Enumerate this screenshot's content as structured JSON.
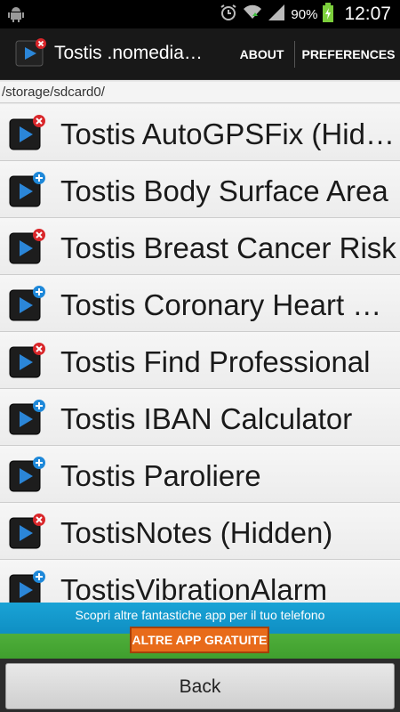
{
  "status_bar": {
    "battery_percent": "90%",
    "time": "12:07",
    "icons": [
      "android-icon",
      "alarm-icon",
      "wifi-icon",
      "signal-icon",
      "battery-charging-icon"
    ]
  },
  "action_bar": {
    "title": "Tostis .nomedia…",
    "about_label": "ABOUT",
    "preferences_label": "PREFERENCES"
  },
  "path": "/storage/sdcard0/",
  "list": {
    "items": [
      {
        "label": "Tostis AutoGPSFix (Hidden)",
        "state": "hidden"
      },
      {
        "label": "Tostis Body Surface Area",
        "state": "visible"
      },
      {
        "label": "Tostis Breast Cancer Risk",
        "state": "hidden"
      },
      {
        "label": "Tostis Coronary Heart Disease",
        "state": "visible"
      },
      {
        "label": "Tostis Find Professional",
        "state": "hidden"
      },
      {
        "label": "Tostis IBAN Calculator",
        "state": "visible"
      },
      {
        "label": "Tostis Paroliere",
        "state": "visible"
      },
      {
        "label": "TostisNotes (Hidden)",
        "state": "hidden"
      },
      {
        "label": "TostisVibrationAlarm",
        "state": "visible"
      }
    ]
  },
  "banner": {
    "message": "Scopri altre fantastiche app per il tuo telefono",
    "cta_label": "ALTRE APP GRATUITE"
  },
  "bottom": {
    "back_label": "Back"
  },
  "colors": {
    "action_bar": "#181818",
    "hidden_badge": "#d9262a",
    "visible_badge": "#1e88d9",
    "banner_blue": "#1aa3d6",
    "banner_green": "#4fae3a",
    "cta_orange": "#e86b1a"
  }
}
